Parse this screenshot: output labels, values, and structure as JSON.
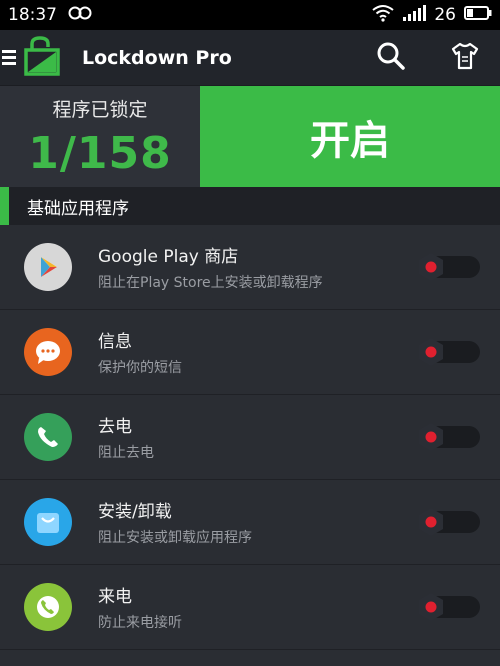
{
  "status_bar": {
    "time": "18:37",
    "battery": "26",
    "icons": [
      "infinity-icon",
      "wifi-icon",
      "signal-icon",
      "battery-icon"
    ]
  },
  "app_bar": {
    "title": "Lockdown Pro",
    "icons": [
      "menu-icon",
      "lock-logo-icon",
      "search-icon",
      "shirt-theme-icon"
    ]
  },
  "hero": {
    "label": "程序已锁定",
    "count": "1/158",
    "action_label": "开启"
  },
  "section": {
    "title": "基础应用程序"
  },
  "apps": [
    {
      "name": "Google Play 商店",
      "description": "阻止在Play Store上安装或卸载程序",
      "icon": "google-play-icon",
      "locked": false
    },
    {
      "name": "信息",
      "description": "保护你的短信",
      "icon": "messages-icon",
      "locked": false
    },
    {
      "name": "去电",
      "description": "阻止去电",
      "icon": "phone-icon",
      "locked": false
    },
    {
      "name": "安装/卸载",
      "description": "阻止安装或卸载应用程序",
      "icon": "installer-bag-icon",
      "locked": false
    },
    {
      "name": "来电",
      "description": "防止来电接听",
      "icon": "incoming-call-icon",
      "locked": false
    }
  ],
  "colors": {
    "accent": "#3bbb47",
    "toggle_dot": "#e0202f"
  }
}
